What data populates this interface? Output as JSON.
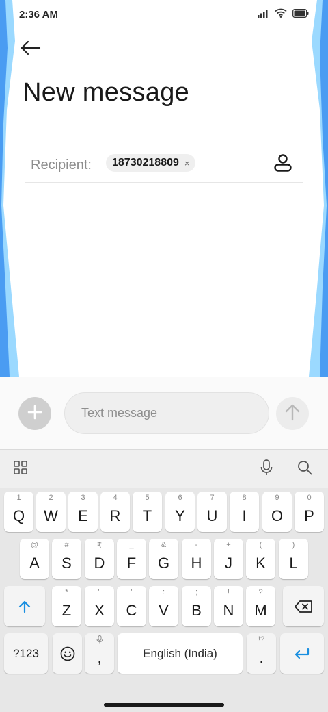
{
  "status_bar": {
    "time": "2:36 AM",
    "icons": [
      "signal-icon",
      "wifi-icon",
      "battery-icon"
    ]
  },
  "header": {
    "back_icon": "arrow-left-icon",
    "title": "New message"
  },
  "recipient": {
    "label": "Recipient:",
    "chips": [
      {
        "number": "18730218809",
        "remove": "×"
      }
    ],
    "contact_icon": "person-icon"
  },
  "compose": {
    "attach_icon": "plus-icon",
    "placeholder": "Text message",
    "value": "",
    "send_icon": "arrow-up-icon"
  },
  "keyboard": {
    "toolbar": {
      "left_icon": "grid-icon",
      "right_icons": [
        "microphone-icon",
        "search-icon"
      ]
    },
    "rows": [
      [
        {
          "main": "Q",
          "sub": "1"
        },
        {
          "main": "W",
          "sub": "2"
        },
        {
          "main": "E",
          "sub": "3"
        },
        {
          "main": "R",
          "sub": "4"
        },
        {
          "main": "T",
          "sub": "5"
        },
        {
          "main": "Y",
          "sub": "6"
        },
        {
          "main": "U",
          "sub": "7"
        },
        {
          "main": "I",
          "sub": "8"
        },
        {
          "main": "O",
          "sub": "9"
        },
        {
          "main": "P",
          "sub": "0"
        }
      ],
      [
        {
          "main": "A",
          "sub": "@"
        },
        {
          "main": "S",
          "sub": "#"
        },
        {
          "main": "D",
          "sub": "₹"
        },
        {
          "main": "F",
          "sub": "_"
        },
        {
          "main": "G",
          "sub": "&"
        },
        {
          "main": "H",
          "sub": "-"
        },
        {
          "main": "J",
          "sub": "+"
        },
        {
          "main": "K",
          "sub": "("
        },
        {
          "main": "L",
          "sub": ")"
        }
      ],
      [
        {
          "main": "Z",
          "sub": "*"
        },
        {
          "main": "X",
          "sub": "\""
        },
        {
          "main": "C",
          "sub": "'"
        },
        {
          "main": "V",
          "sub": ":"
        },
        {
          "main": "B",
          "sub": ";"
        },
        {
          "main": "N",
          "sub": "!"
        },
        {
          "main": "M",
          "sub": "?"
        }
      ]
    ],
    "shift_icon": "shift-arrow-icon",
    "backspace_icon": "backspace-icon",
    "bottom_row": {
      "symbols_label": "?123",
      "emoji_icon": "emoji-icon",
      "comma_label": ",",
      "comma_icon": "microphone-icon",
      "space_label": "English (India)",
      "period_label": ".",
      "period_sub": "!?",
      "enter_icon": "enter-icon"
    }
  },
  "colors": {
    "accent_blue": "#1a8fe0",
    "edge_light_blue": "#9bd9ff",
    "edge_dark_blue": "#4a9cf2",
    "keyboard_bg": "#e7e7e7",
    "key_bg": "#ffffff"
  }
}
